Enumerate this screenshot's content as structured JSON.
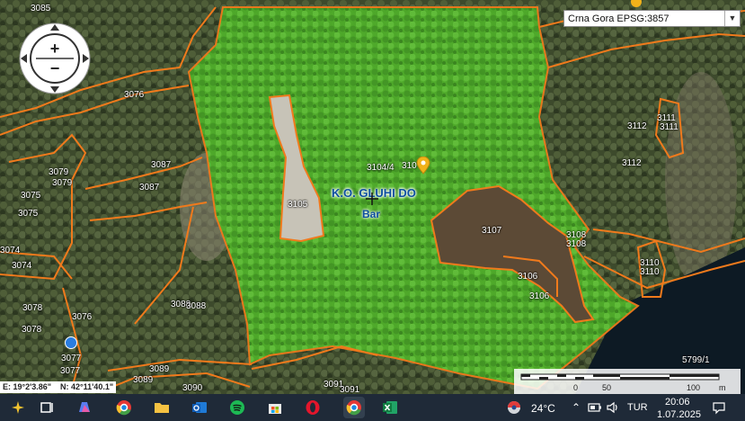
{
  "crs": {
    "selected": "Crna Gora EPSG:3857"
  },
  "map": {
    "place_name": "K.O. GLUHI DO",
    "place_sub": "Bar",
    "parcels": [
      "3085",
      "3076",
      "3079",
      "3079",
      "3075",
      "3075",
      "3087",
      "3087",
      "3074",
      "3074",
      "3078",
      "3078",
      "3076",
      "3077",
      "3077",
      "3089",
      "3089",
      "3090",
      "3088",
      "3088",
      "3104/4",
      "310",
      "3105",
      "3107",
      "3108",
      "3108",
      "3106",
      "3106",
      "3111",
      "3111",
      "3112",
      "3112",
      "3110",
      "3110",
      "3091",
      "3091",
      "5799/1"
    ],
    "coords": {
      "lon": "E: 19°2'3.86\"",
      "lat": "N: 42°11'40.1\""
    },
    "scale": {
      "ticks": [
        "0",
        "50",
        "100"
      ],
      "unit": "m"
    }
  },
  "taskbar": {
    "temperature": "24°C",
    "language": "TUR",
    "time": "20:06",
    "date": "1.07.2025"
  },
  "colors": {
    "highlight": "#5fc32a",
    "parcel_border": "#f07a1c",
    "taskbar": "#1f2a38"
  }
}
